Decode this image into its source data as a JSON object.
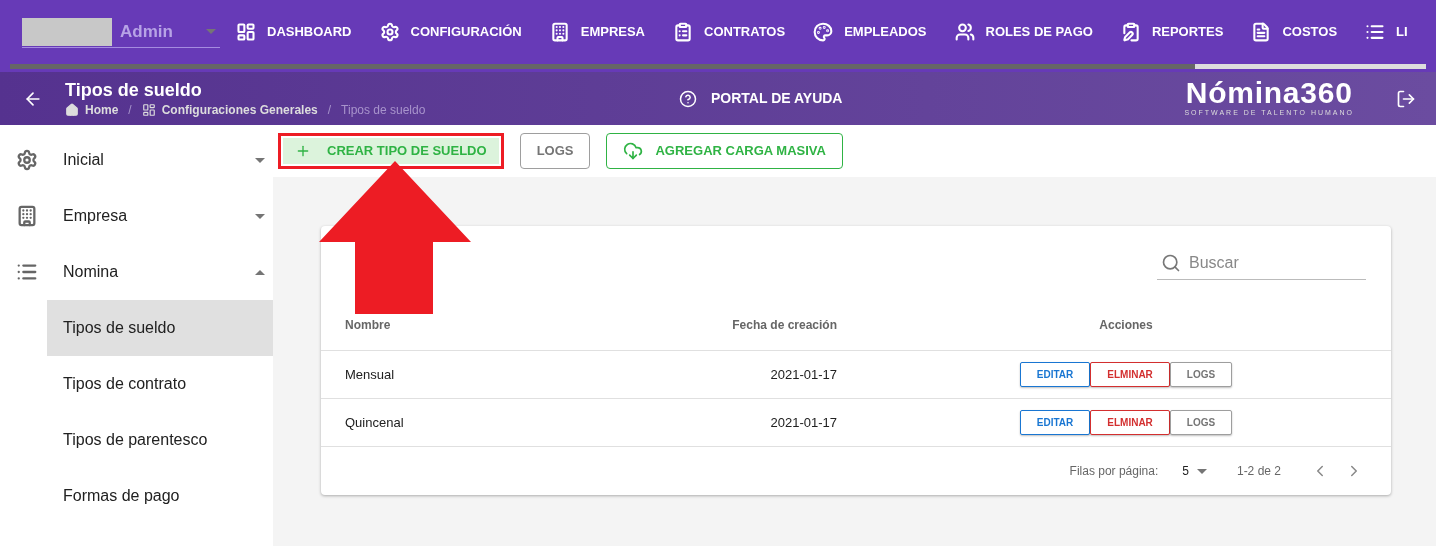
{
  "user_select": {
    "value": "Admin"
  },
  "nav": [
    {
      "label": "DASHBOARD"
    },
    {
      "label": "CONFIGURACIÓN"
    },
    {
      "label": "EMPRESA"
    },
    {
      "label": "CONTRATOS"
    },
    {
      "label": "EMPLEADOS"
    },
    {
      "label": "ROLES DE PAGO"
    },
    {
      "label": "REPORTES"
    },
    {
      "label": "COSTOS"
    },
    {
      "label": "LI"
    }
  ],
  "header": {
    "title": "Tipos de sueldo",
    "breadcrumbs": [
      "Home",
      "Configuraciones Generales",
      "Tipos de sueldo"
    ],
    "separator": "/",
    "help": "PORTAL DE AYUDA",
    "logo": {
      "name": "Nómina360",
      "tagline": "SOFTWARE DE TALENTO HUMANO"
    }
  },
  "sidebar": [
    {
      "label": "Inicial",
      "expanded": false
    },
    {
      "label": "Empresa",
      "expanded": false
    },
    {
      "label": "Nomina",
      "expanded": true,
      "children": [
        {
          "label": "Tipos de sueldo",
          "selected": true
        },
        {
          "label": "Tipos de contrato",
          "selected": false
        },
        {
          "label": "Tipos de parentesco",
          "selected": false
        },
        {
          "label": "Formas de pago",
          "selected": false
        }
      ]
    }
  ],
  "toolbar": [
    {
      "label": "CREAR TIPO DE SUELDO",
      "kind": "create"
    },
    {
      "label": "LOGS",
      "kind": "plain"
    },
    {
      "label": "AGREGAR CARGA MASIVA",
      "kind": "upload"
    }
  ],
  "search": {
    "placeholder": "Buscar"
  },
  "table": {
    "columns": [
      "Nombre",
      "Fecha de creación",
      "Acciones"
    ],
    "rows": [
      {
        "cells": [
          "Mensual",
          "2021-01-17"
        ],
        "actions": [
          "EDITAR",
          "ELMINAR",
          "LOGS"
        ]
      },
      {
        "cells": [
          "Quincenal",
          "2021-01-17"
        ],
        "actions": [
          "EDITAR",
          "ELMINAR",
          "LOGS"
        ]
      }
    ]
  },
  "pagination": {
    "rows_label": "Filas por página:",
    "rows_per_page": "5",
    "range": "1-2 de 2"
  }
}
